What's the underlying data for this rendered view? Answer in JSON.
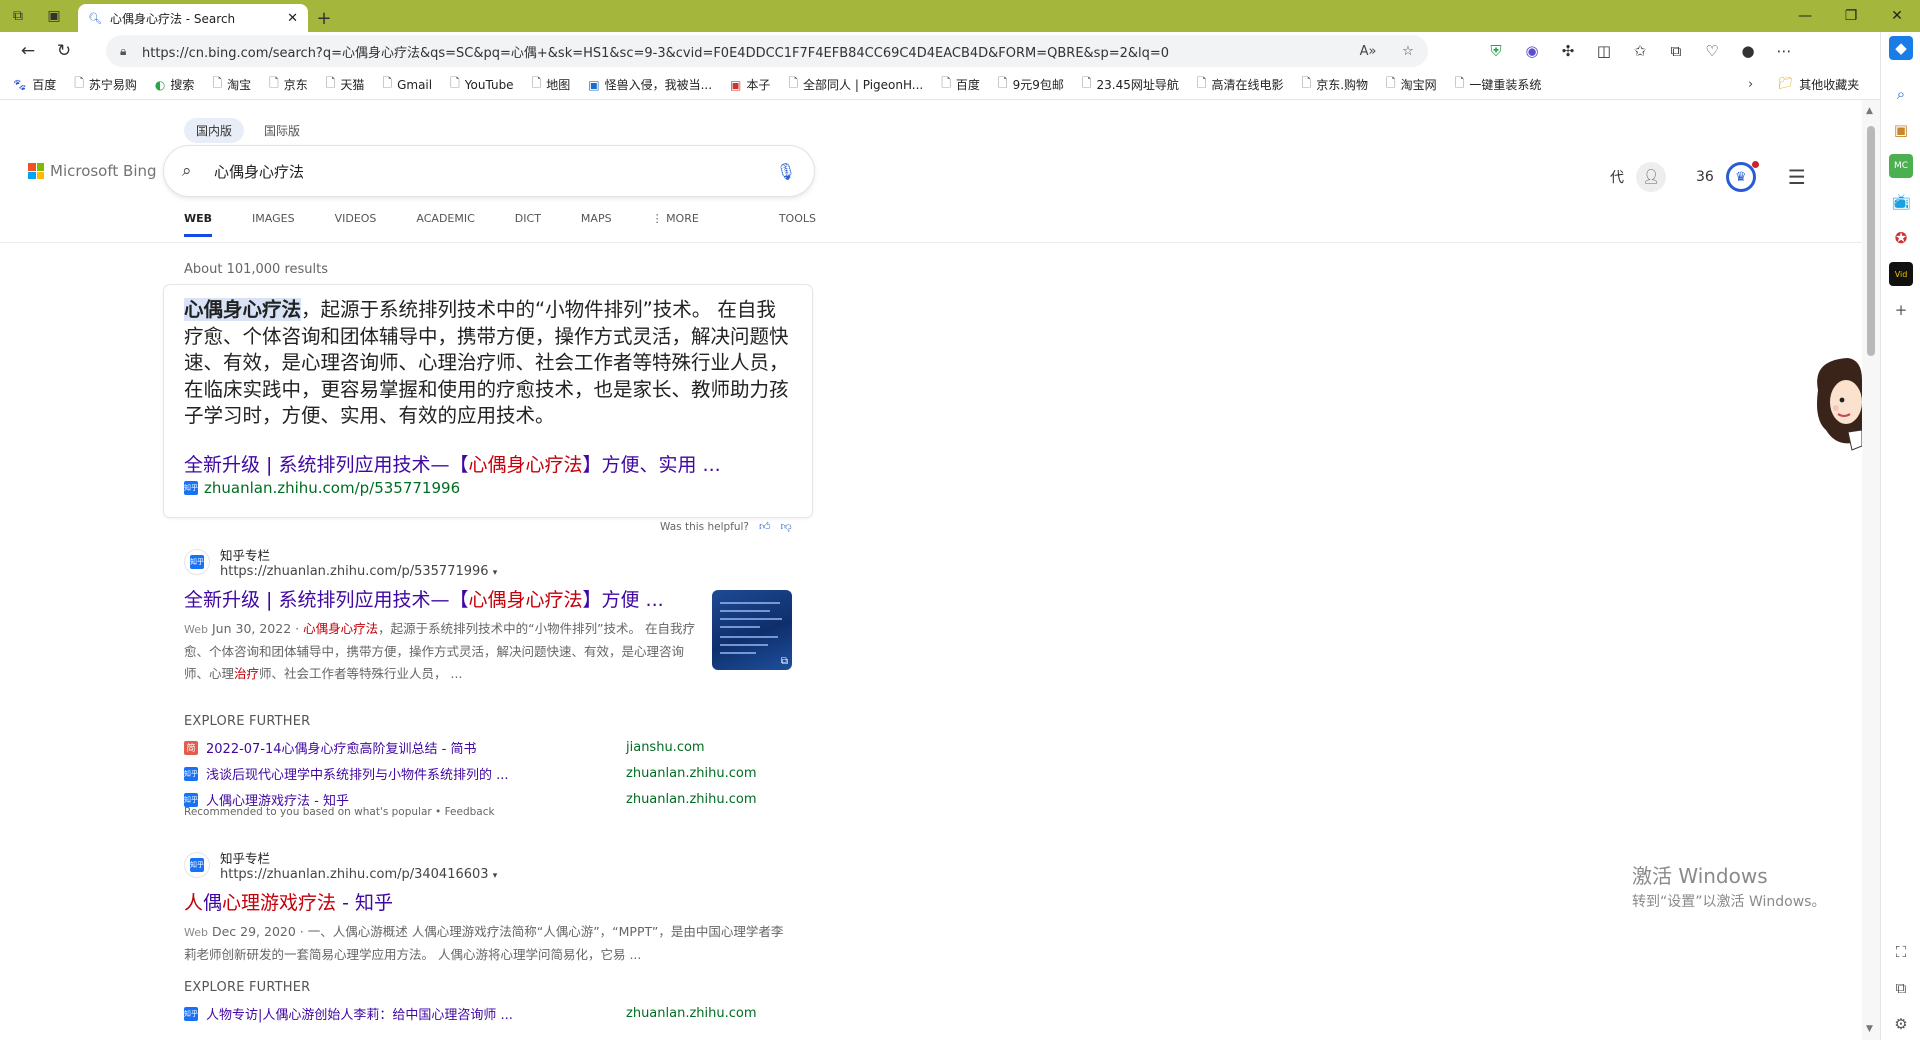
{
  "browser": {
    "tab_title": "心偶身心疗法 - Search",
    "new_tab": "+",
    "url": "https://cn.bing.com/search?q=心偶身心疗法&qs=SC&pq=心偶+&sk=HS1&sc=9-3&cvid=F0E4DDCC1F7F4EFB84CC69C4D4EACB4D&FORM=QBRE&sp=2&lq=0"
  },
  "bookmarks": [
    "百度",
    "苏宁易购",
    "搜索",
    "淘宝",
    "京东",
    "天猫",
    "Gmail",
    "YouTube",
    "地图",
    "怪兽入侵，我被当...",
    "本子",
    "全部同人 | PigeonH...",
    "百度",
    "9元9包邮",
    "23.45网址导航",
    "高清在线电影",
    "京东.购物",
    "淘宝网",
    "一键重装系统"
  ],
  "bookmarks_other": "其他收藏夹",
  "bing": {
    "region_tabs": [
      "国内版",
      "国际版"
    ],
    "logo_text": "Microsoft Bing",
    "query": "心偶身心疗法",
    "user_char": "代",
    "points": "36",
    "nav_tabs": [
      "WEB",
      "IMAGES",
      "VIDEOS",
      "ACADEMIC",
      "DICT",
      "MAPS",
      "MORE",
      "TOOLS"
    ],
    "results_count": "About 101,000 results"
  },
  "answer": {
    "highlight": "心偶身心疗法",
    "text": "，起源于系统排列技术中的“小物件排列”技术。 在自我疗愈、个体咨询和团体辅导中，携带方便，操作方式灵活，解决问题快速、有效，是心理咨询师、心理治疗师、社会工作者等特殊行业人员，在临床实践中，更容易掌握和使用的疗愈技术，也是家长、教师助力孩子学习时，方便、实用、有效的应用技术。",
    "link_pre": "全新升级 | 系统排列应用技术—【",
    "link_hl": "心偶身心疗法",
    "link_post": "】方便、实用 ...",
    "site": "zhuanlan.zhihu.com/p/535771996",
    "helpful": "Was this helpful?"
  },
  "results": [
    {
      "site_name": "知乎专栏",
      "url": "https://zhuanlan.zhihu.com/p/535771996",
      "title_pre": "全新升级 | 系统排列应用技术—【",
      "title_hl": "心偶身心疗法",
      "title_post": "】方便 ...",
      "tag": "Web",
      "date": "Jun 30, 2022",
      "sep": " · ",
      "snip_hl": "心偶身心疗法",
      "snip_1": "，起源于系统排列技术中的“小物件排列”技术。 在自我疗愈、个体咨询和团体辅导中，携带方便，操作方式灵活，解决问题快速、有效，是心理咨询师、心理",
      "snip_hl2": "治疗",
      "snip_2": "师、社会工作者等特殊行业人员， ..."
    },
    {
      "site_name": "知乎专栏",
      "url": "https://zhuanlan.zhihu.com/p/340416603",
      "title_a": "人",
      "title_b": "偶",
      "title_c": "心理游戏",
      "title_d": "疗法",
      "title_e": " - 知乎",
      "tag": "Web",
      "date": "Dec 29, 2020",
      "snip": "· 一、人偶心游概述 人偶心理游戏疗法简称“人偶心游”，“MPPT”，是由中国心理学者李莉老师创新研发的一套简易心理学应用方法。 人偶心游将心理学问简易化，它易 ..."
    }
  ],
  "explore_label": "EXPLORE FURTHER",
  "explore_1": [
    {
      "icon": "简",
      "text": "2022-07-14心偶身心疗愈高阶复训总结 - 简书",
      "domain": "jianshu.com"
    },
    {
      "icon": "知乎",
      "text": "浅谈后现代心理学中系统排列与小物件系统排列的 ...",
      "domain": "zhuanlan.zhihu.com"
    },
    {
      "icon": "知乎",
      "text": "人偶心理游戏疗法 - 知乎",
      "domain": "zhuanlan.zhihu.com"
    }
  ],
  "recommended": "Recommended to you based on what's popular • Feedback",
  "explore_2": [
    {
      "icon": "知乎",
      "text": "人物专访|人偶心游创始人李莉：给中国心理咨询师 ...",
      "domain": "zhuanlan.zhihu.com"
    }
  ],
  "watermark": {
    "line1": "激活 Windows",
    "line2": "转到“设置”以激活 Windows。"
  },
  "colors": {
    "titlebar": "#a4b63c",
    "link": "#4007a2",
    "highlight": "#c5000a",
    "domain_green": "#006d21",
    "accent": "#174ae4"
  }
}
